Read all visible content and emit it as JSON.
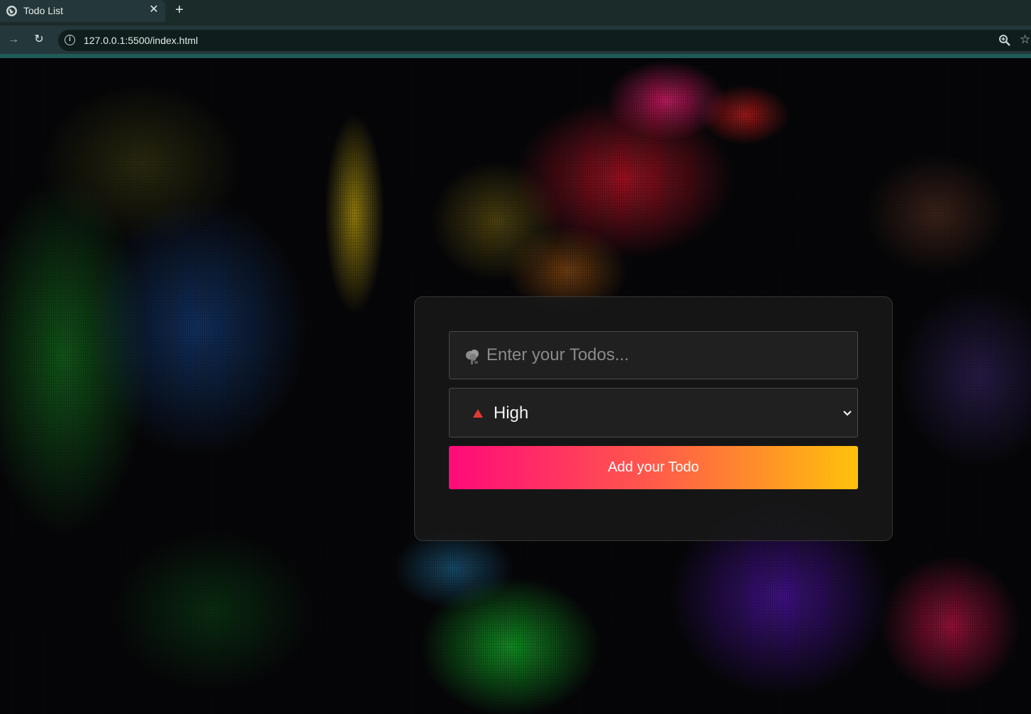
{
  "browser": {
    "tab": {
      "title": "Todo List",
      "close_glyph": "✕"
    },
    "new_tab_glyph": "+",
    "nav": {
      "forward_glyph": "→",
      "reload_glyph": "↻"
    },
    "url": "127.0.0.1:5500/index.html",
    "icons": [
      "globe-icon",
      "close-icon",
      "plus-icon",
      "forward-icon",
      "reload-icon",
      "site-info-icon",
      "zoom-icon",
      "star-icon"
    ],
    "colors": {
      "tabbar": "#1b2b29",
      "toolbar": "#24373a",
      "accent": "#1e5a58"
    }
  },
  "todo_form": {
    "input": {
      "placeholder": "Enter your Todos...",
      "value": "",
      "icon": "thought-bubble-icon"
    },
    "priority": {
      "selected": "High",
      "icon": "red-triangle-icon",
      "options": [
        "High"
      ]
    },
    "add_button_label": "Add your Todo",
    "colors": {
      "button_start": "#ff0a7a",
      "button_mid": "#ff5a4a",
      "button_end": "#ffc20a",
      "priority_icon": "#e53935"
    }
  }
}
